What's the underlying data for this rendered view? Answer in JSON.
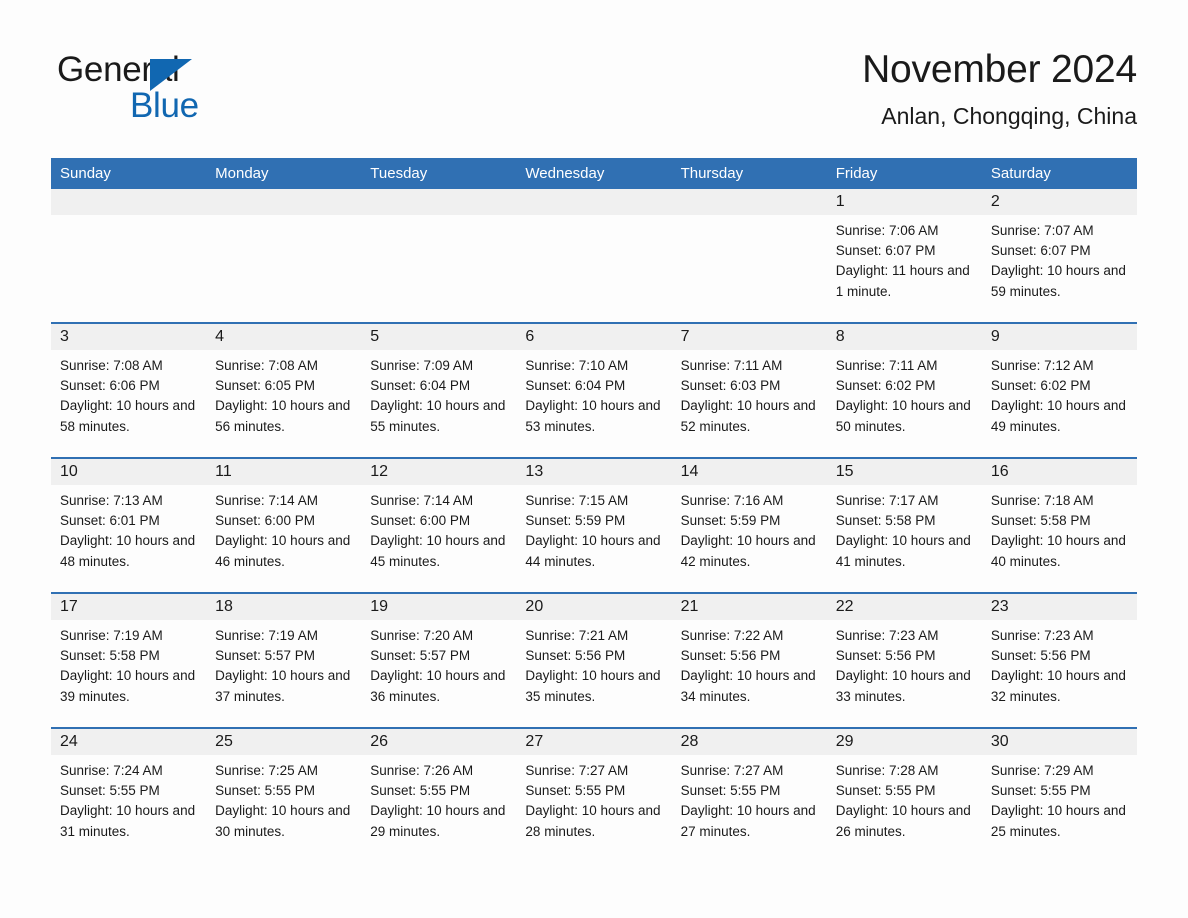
{
  "brand": {
    "name_part1": "General",
    "name_part2": "Blue",
    "triangle_color": "#1167b1"
  },
  "header": {
    "title": "November 2024",
    "subtitle": "Anlan, Chongqing, China"
  },
  "theme": {
    "accent_blue": "#3070b3",
    "day_band_gray": "#f0f0f0",
    "page_background": "#fdfdfd",
    "text_color": "#1a1a1a"
  },
  "weekdays": [
    "Sunday",
    "Monday",
    "Tuesday",
    "Wednesday",
    "Thursday",
    "Friday",
    "Saturday"
  ],
  "weeks": [
    [
      {
        "date": "",
        "sunrise": "",
        "sunset": "",
        "daylight": ""
      },
      {
        "date": "",
        "sunrise": "",
        "sunset": "",
        "daylight": ""
      },
      {
        "date": "",
        "sunrise": "",
        "sunset": "",
        "daylight": ""
      },
      {
        "date": "",
        "sunrise": "",
        "sunset": "",
        "daylight": ""
      },
      {
        "date": "",
        "sunrise": "",
        "sunset": "",
        "daylight": ""
      },
      {
        "date": "1",
        "sunrise": "Sunrise: 7:06 AM",
        "sunset": "Sunset: 6:07 PM",
        "daylight": "Daylight: 11 hours and 1 minute."
      },
      {
        "date": "2",
        "sunrise": "Sunrise: 7:07 AM",
        "sunset": "Sunset: 6:07 PM",
        "daylight": "Daylight: 10 hours and 59 minutes."
      }
    ],
    [
      {
        "date": "3",
        "sunrise": "Sunrise: 7:08 AM",
        "sunset": "Sunset: 6:06 PM",
        "daylight": "Daylight: 10 hours and 58 minutes."
      },
      {
        "date": "4",
        "sunrise": "Sunrise: 7:08 AM",
        "sunset": "Sunset: 6:05 PM",
        "daylight": "Daylight: 10 hours and 56 minutes."
      },
      {
        "date": "5",
        "sunrise": "Sunrise: 7:09 AM",
        "sunset": "Sunset: 6:04 PM",
        "daylight": "Daylight: 10 hours and 55 minutes."
      },
      {
        "date": "6",
        "sunrise": "Sunrise: 7:10 AM",
        "sunset": "Sunset: 6:04 PM",
        "daylight": "Daylight: 10 hours and 53 minutes."
      },
      {
        "date": "7",
        "sunrise": "Sunrise: 7:11 AM",
        "sunset": "Sunset: 6:03 PM",
        "daylight": "Daylight: 10 hours and 52 minutes."
      },
      {
        "date": "8",
        "sunrise": "Sunrise: 7:11 AM",
        "sunset": "Sunset: 6:02 PM",
        "daylight": "Daylight: 10 hours and 50 minutes."
      },
      {
        "date": "9",
        "sunrise": "Sunrise: 7:12 AM",
        "sunset": "Sunset: 6:02 PM",
        "daylight": "Daylight: 10 hours and 49 minutes."
      }
    ],
    [
      {
        "date": "10",
        "sunrise": "Sunrise: 7:13 AM",
        "sunset": "Sunset: 6:01 PM",
        "daylight": "Daylight: 10 hours and 48 minutes."
      },
      {
        "date": "11",
        "sunrise": "Sunrise: 7:14 AM",
        "sunset": "Sunset: 6:00 PM",
        "daylight": "Daylight: 10 hours and 46 minutes."
      },
      {
        "date": "12",
        "sunrise": "Sunrise: 7:14 AM",
        "sunset": "Sunset: 6:00 PM",
        "daylight": "Daylight: 10 hours and 45 minutes."
      },
      {
        "date": "13",
        "sunrise": "Sunrise: 7:15 AM",
        "sunset": "Sunset: 5:59 PM",
        "daylight": "Daylight: 10 hours and 44 minutes."
      },
      {
        "date": "14",
        "sunrise": "Sunrise: 7:16 AM",
        "sunset": "Sunset: 5:59 PM",
        "daylight": "Daylight: 10 hours and 42 minutes."
      },
      {
        "date": "15",
        "sunrise": "Sunrise: 7:17 AM",
        "sunset": "Sunset: 5:58 PM",
        "daylight": "Daylight: 10 hours and 41 minutes."
      },
      {
        "date": "16",
        "sunrise": "Sunrise: 7:18 AM",
        "sunset": "Sunset: 5:58 PM",
        "daylight": "Daylight: 10 hours and 40 minutes."
      }
    ],
    [
      {
        "date": "17",
        "sunrise": "Sunrise: 7:19 AM",
        "sunset": "Sunset: 5:58 PM",
        "daylight": "Daylight: 10 hours and 39 minutes."
      },
      {
        "date": "18",
        "sunrise": "Sunrise: 7:19 AM",
        "sunset": "Sunset: 5:57 PM",
        "daylight": "Daylight: 10 hours and 37 minutes."
      },
      {
        "date": "19",
        "sunrise": "Sunrise: 7:20 AM",
        "sunset": "Sunset: 5:57 PM",
        "daylight": "Daylight: 10 hours and 36 minutes."
      },
      {
        "date": "20",
        "sunrise": "Sunrise: 7:21 AM",
        "sunset": "Sunset: 5:56 PM",
        "daylight": "Daylight: 10 hours and 35 minutes."
      },
      {
        "date": "21",
        "sunrise": "Sunrise: 7:22 AM",
        "sunset": "Sunset: 5:56 PM",
        "daylight": "Daylight: 10 hours and 34 minutes."
      },
      {
        "date": "22",
        "sunrise": "Sunrise: 7:23 AM",
        "sunset": "Sunset: 5:56 PM",
        "daylight": "Daylight: 10 hours and 33 minutes."
      },
      {
        "date": "23",
        "sunrise": "Sunrise: 7:23 AM",
        "sunset": "Sunset: 5:56 PM",
        "daylight": "Daylight: 10 hours and 32 minutes."
      }
    ],
    [
      {
        "date": "24",
        "sunrise": "Sunrise: 7:24 AM",
        "sunset": "Sunset: 5:55 PM",
        "daylight": "Daylight: 10 hours and 31 minutes."
      },
      {
        "date": "25",
        "sunrise": "Sunrise: 7:25 AM",
        "sunset": "Sunset: 5:55 PM",
        "daylight": "Daylight: 10 hours and 30 minutes."
      },
      {
        "date": "26",
        "sunrise": "Sunrise: 7:26 AM",
        "sunset": "Sunset: 5:55 PM",
        "daylight": "Daylight: 10 hours and 29 minutes."
      },
      {
        "date": "27",
        "sunrise": "Sunrise: 7:27 AM",
        "sunset": "Sunset: 5:55 PM",
        "daylight": "Daylight: 10 hours and 28 minutes."
      },
      {
        "date": "28",
        "sunrise": "Sunrise: 7:27 AM",
        "sunset": "Sunset: 5:55 PM",
        "daylight": "Daylight: 10 hours and 27 minutes."
      },
      {
        "date": "29",
        "sunrise": "Sunrise: 7:28 AM",
        "sunset": "Sunset: 5:55 PM",
        "daylight": "Daylight: 10 hours and 26 minutes."
      },
      {
        "date": "30",
        "sunrise": "Sunrise: 7:29 AM",
        "sunset": "Sunset: 5:55 PM",
        "daylight": "Daylight: 10 hours and 25 minutes."
      }
    ]
  ]
}
